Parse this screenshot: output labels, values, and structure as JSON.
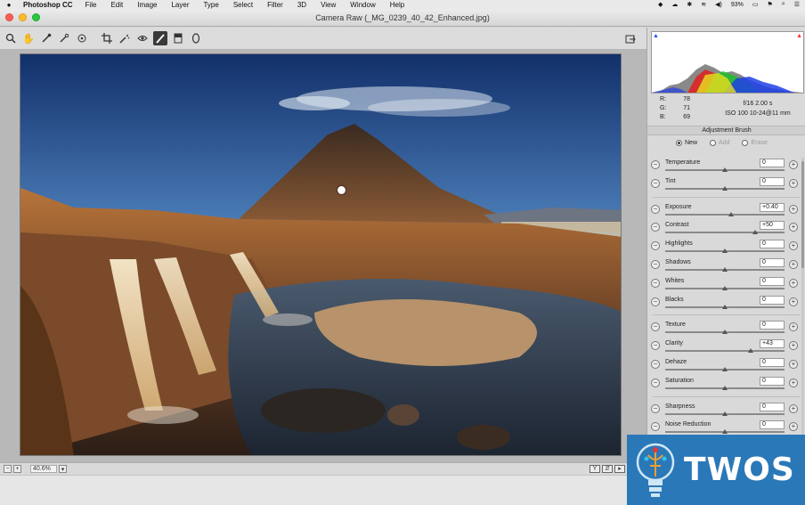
{
  "menubar": {
    "app_name": "Photoshop CC",
    "menus": [
      "File",
      "Edit",
      "Image",
      "Layer",
      "Type",
      "Select",
      "Filter",
      "3D",
      "View",
      "Window",
      "Help"
    ],
    "battery": "93%"
  },
  "window": {
    "title": "Camera Raw (_MG_0239_40_42_Enhanced.jpg)"
  },
  "toolbar": {
    "tools": [
      "zoom-tool",
      "hand-tool",
      "white-balance-tool",
      "color-sampler-tool",
      "targeted-adjustment-tool",
      "crop-tool",
      "spot-removal-tool",
      "red-eye-tool",
      "adjustment-brush-tool",
      "graduated-filter-tool",
      "radial-filter-tool"
    ],
    "active_tool": "adjustment-brush-tool"
  },
  "status": {
    "zoom": "40.6%"
  },
  "readout": {
    "r_label": "R:",
    "r": "78",
    "g_label": "G:",
    "g": "71",
    "b_label": "B:",
    "b": "69",
    "aperture_shutter": "f/16   2.00 s",
    "iso_lens": "ISO 100   10-24@11 mm"
  },
  "panel": {
    "title": "Adjustment Brush",
    "modes": [
      {
        "label": "New",
        "selected": true
      },
      {
        "label": "Add",
        "selected": false
      },
      {
        "label": "Erase",
        "selected": false
      }
    ]
  },
  "sliders": [
    {
      "label": "Temperature",
      "value": "0",
      "level": 0.5,
      "group": 1
    },
    {
      "label": "Tint",
      "value": "0",
      "level": 0.5,
      "group": 1
    },
    {
      "label": "Exposure",
      "value": "+0.40",
      "level": 0.55,
      "group": 2
    },
    {
      "label": "Contrast",
      "value": "+50",
      "level": 0.75,
      "group": 2
    },
    {
      "label": "Highlights",
      "value": "0",
      "level": 0.5,
      "group": 2
    },
    {
      "label": "Shadows",
      "value": "0",
      "level": 0.5,
      "group": 2
    },
    {
      "label": "Whites",
      "value": "0",
      "level": 0.5,
      "group": 2
    },
    {
      "label": "Blacks",
      "value": "0",
      "level": 0.5,
      "group": 2
    },
    {
      "label": "Texture",
      "value": "0",
      "level": 0.5,
      "group": 3
    },
    {
      "label": "Clarity",
      "value": "+43",
      "level": 0.715,
      "group": 3
    },
    {
      "label": "Dehaze",
      "value": "0",
      "level": 0.5,
      "group": 3
    },
    {
      "label": "Saturation",
      "value": "0",
      "level": 0.5,
      "group": 3
    },
    {
      "label": "Sharpness",
      "value": "0",
      "level": 0.5,
      "group": 4
    },
    {
      "label": "Noise Reduction",
      "value": "0",
      "level": 0.5,
      "group": 4
    }
  ],
  "watermark": {
    "text": "TWOS"
  },
  "colors": {
    "accent_blue": "#2a78b8",
    "toolbar_bg": "#dcdcdc",
    "panel_bg": "#d9d9d9"
  }
}
